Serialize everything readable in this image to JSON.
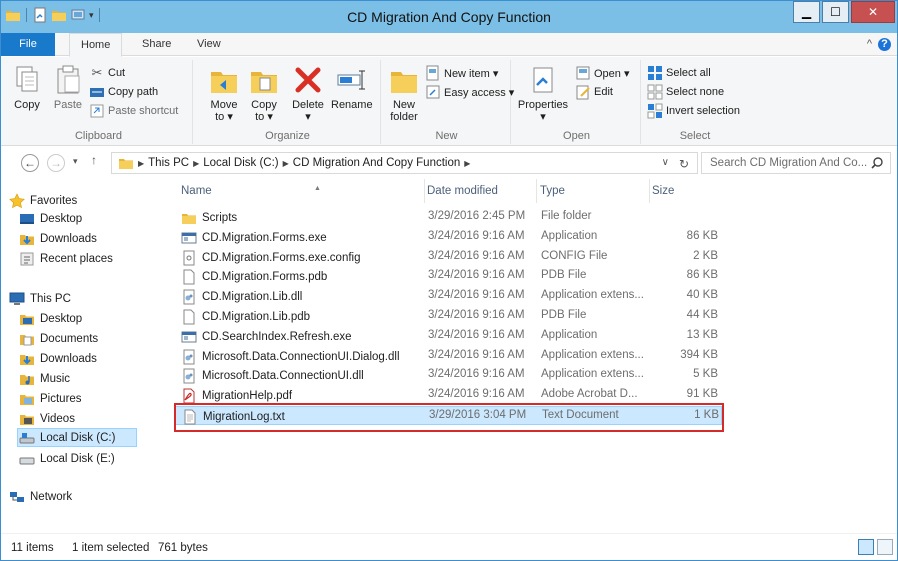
{
  "window": {
    "title": "CD Migration And Copy Function"
  },
  "ribbon_tabs": {
    "file": "File",
    "home": "Home",
    "share": "Share",
    "view": "View"
  },
  "clipboard": {
    "group": "Clipboard",
    "copy": "Copy",
    "paste": "Paste",
    "cut": "Cut",
    "copy_path": "Copy path",
    "paste_shortcut": "Paste shortcut"
  },
  "organize": {
    "group": "Organize",
    "move_to_1": "Move",
    "move_to_2": "to ▾",
    "copy_to_1": "Copy",
    "copy_to_2": "to ▾",
    "delete": "Delete",
    "delete_arrow": "▾",
    "rename": "Rename"
  },
  "new": {
    "group": "New",
    "new_folder_1": "New",
    "new_folder_2": "folder",
    "new_item": "New item ▾",
    "easy_access": "Easy access ▾"
  },
  "open": {
    "group": "Open",
    "properties": "Properties",
    "properties_arrow": "▾",
    "open": "Open ▾",
    "edit": "Edit"
  },
  "select": {
    "group": "Select",
    "select_all": "Select all",
    "select_none": "Select none",
    "invert": "Invert selection"
  },
  "address": {
    "crumbs": [
      "This PC",
      "Local Disk (C:)",
      "CD Migration And Copy Function"
    ],
    "search_placeholder": "Search CD Migration And Co..."
  },
  "nav": {
    "favorites": "Favorites",
    "desktop": "Desktop",
    "downloads": "Downloads",
    "recent": "Recent places",
    "this_pc": "This PC",
    "pc_desktop": "Desktop",
    "documents": "Documents",
    "pc_downloads": "Downloads",
    "music": "Music",
    "pictures": "Pictures",
    "videos": "Videos",
    "local_c": "Local Disk (C:)",
    "local_e": "Local Disk (E:)",
    "network": "Network"
  },
  "columns": {
    "name": "Name",
    "date": "Date modified",
    "type": "Type",
    "size": "Size"
  },
  "files": [
    {
      "name": "Scripts",
      "date": "3/29/2016 2:45 PM",
      "type": "File folder",
      "size": "",
      "icon": "folder"
    },
    {
      "name": "CD.Migration.Forms.exe",
      "date": "3/24/2016 9:16 AM",
      "type": "Application",
      "size": "86 KB",
      "icon": "exe"
    },
    {
      "name": "CD.Migration.Forms.exe.config",
      "date": "3/24/2016 9:16 AM",
      "type": "CONFIG File",
      "size": "2 KB",
      "icon": "config"
    },
    {
      "name": "CD.Migration.Forms.pdb",
      "date": "3/24/2016 9:16 AM",
      "type": "PDB File",
      "size": "86 KB",
      "icon": "file"
    },
    {
      "name": "CD.Migration.Lib.dll",
      "date": "3/24/2016 9:16 AM",
      "type": "Application extens...",
      "size": "40 KB",
      "icon": "dll"
    },
    {
      "name": "CD.Migration.Lib.pdb",
      "date": "3/24/2016 9:16 AM",
      "type": "PDB File",
      "size": "44 KB",
      "icon": "file"
    },
    {
      "name": "CD.SearchIndex.Refresh.exe",
      "date": "3/24/2016 9:16 AM",
      "type": "Application",
      "size": "13 KB",
      "icon": "exe"
    },
    {
      "name": "Microsoft.Data.ConnectionUI.Dialog.dll",
      "date": "3/24/2016 9:16 AM",
      "type": "Application extens...",
      "size": "394 KB",
      "icon": "dll"
    },
    {
      "name": "Microsoft.Data.ConnectionUI.dll",
      "date": "3/24/2016 9:16 AM",
      "type": "Application extens...",
      "size": "5 KB",
      "icon": "dll"
    },
    {
      "name": "MigrationHelp.pdf",
      "date": "3/24/2016 9:16 AM",
      "type": "Adobe Acrobat D...",
      "size": "91 KB",
      "icon": "pdf"
    },
    {
      "name": "MigrationLog.txt",
      "date": "3/29/2016 3:04 PM",
      "type": "Text Document",
      "size": "1 KB",
      "icon": "txt"
    }
  ],
  "status": {
    "items": "11 items",
    "selected": "1 item selected",
    "bytes": "761 bytes"
  }
}
